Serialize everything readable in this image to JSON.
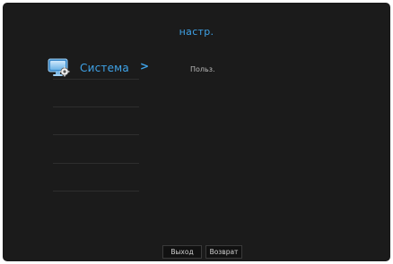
{
  "header": {
    "title": "настр."
  },
  "menu": {
    "items": [
      {
        "label": "Система",
        "icon": "monitor-gear-icon",
        "selected": true,
        "chevron": ">"
      }
    ]
  },
  "submenu": {
    "items": [
      {
        "label": "Польз."
      }
    ]
  },
  "footer": {
    "exit_label": "Выход",
    "return_label": "Возврат"
  },
  "colors": {
    "background": "#1b1b1b",
    "accent": "#3fa3e8",
    "text": "#b8b8b8"
  }
}
